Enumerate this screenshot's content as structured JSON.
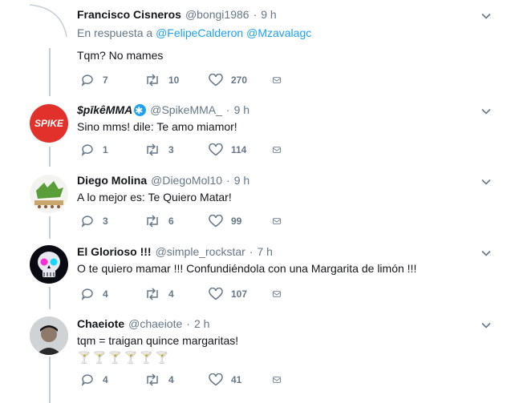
{
  "tweets": [
    {
      "name": "Francisco Cisneros",
      "handle": "@bongi1986",
      "time": "9 h",
      "reply_prefix": "En respuesta a",
      "reply_users": [
        "@FelipeCalderon",
        "@Mzavalagc"
      ],
      "text": "Tqm? No mames",
      "replies": "7",
      "retweets": "10",
      "likes": "270"
    },
    {
      "name": "$pikeCMMA",
      "handle": "@SpikeMMA_",
      "time": "9 h",
      "text": "Sino mms! dile: Te amo miamor!",
      "avatar_text": "SPIKE",
      "replies": "1",
      "retweets": "3",
      "likes": "114"
    },
    {
      "name": "Diego Molina",
      "handle": "@DiegoMol10",
      "time": "9 h",
      "text": "A lo mejor es: Te Quiero Matar!",
      "replies": "3",
      "retweets": "6",
      "likes": "99"
    },
    {
      "name": "El Glorioso !!!",
      "handle": "@simple_rockstar",
      "time": "7 h",
      "text": "O te quiero mamar !!! Confundiéndola con una Margarita de limón !!!",
      "replies": "4",
      "retweets": "4",
      "likes": "107"
    },
    {
      "name": "Chaeiote",
      "handle": "@chaeiote",
      "time": "2 h",
      "text": "tqm = traigan quince margaritas!",
      "emoji": "🍸🍸🍸🍸🍸🍸",
      "replies": "4",
      "retweets": "4",
      "likes": "41"
    }
  ],
  "separator": "·",
  "colors": {
    "accent": "#1da1f2",
    "muted": "#657786",
    "thread": "#c4cfd6"
  }
}
